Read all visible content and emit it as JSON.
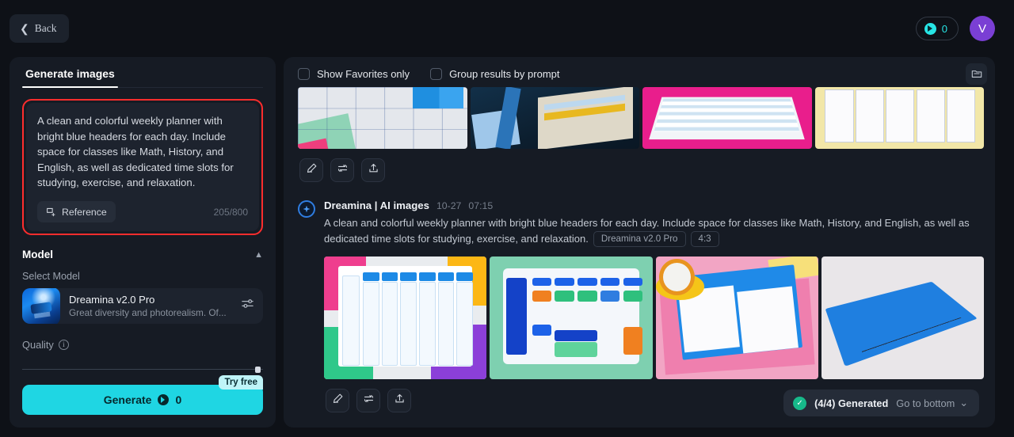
{
  "topbar": {
    "back_label": "Back",
    "back_icon": "chevron-left-icon",
    "credits_value": "0",
    "credits_icon": "credit-coin-icon",
    "avatar_initial": "V",
    "accent_cyan": "#1fd6e3",
    "avatar_color": "#7a3fd4"
  },
  "sidebar": {
    "tab_label": "Generate images",
    "prompt": {
      "text": "A clean and colorful weekly planner with bright blue headers for each day. Include space for classes like Math, History, and English, as well as dedicated time slots for studying, exercise, and relaxation.",
      "reference_label": "Reference",
      "reference_icon": "add-image-icon",
      "counter": "205/800",
      "highlight_color": "#ff2d2d"
    },
    "model_section": {
      "title": "Model",
      "collapse_icon": "chevron-up-icon",
      "select_label": "Select Model",
      "model_name": "Dreamina v2.0 Pro",
      "model_desc": "Great diversity and photorealism. Of...",
      "settings_icon": "sliders-icon"
    },
    "quality": {
      "label": "Quality",
      "info_icon": "info-icon",
      "value_percent": 99
    },
    "generate": {
      "label": "Generate",
      "cost": "0",
      "coin_icon": "credit-coin-icon",
      "try_free_label": "Try free"
    }
  },
  "main": {
    "toolbar": {
      "favorites_label": "Show Favorites only",
      "favorites_checked": false,
      "group_label": "Group results by prompt",
      "group_checked": false,
      "archive_icon": "folder-icon"
    },
    "previous_result": {
      "images": [
        {
          "alt": "weekly planner grid closeup",
          "art": "r1a"
        },
        {
          "alt": "open planner with blue ribbons",
          "art": "r1b"
        },
        {
          "alt": "open planner on pink background",
          "art": "r1c"
        },
        {
          "alt": "fanned planner cards on yellow",
          "art": "r1d"
        }
      ],
      "actions": [
        {
          "name": "edit-button",
          "icon": "pencil-icon"
        },
        {
          "name": "regenerate-button",
          "icon": "loop-arrows-icon"
        },
        {
          "name": "share-button",
          "icon": "upload-icon"
        }
      ]
    },
    "entry": {
      "app_icon": "dreamina-spark-icon",
      "title": "Dreamina | AI images",
      "date": "10-27",
      "time": "07:15",
      "prompt": "A clean and colorful weekly planner with bright blue headers for each day. Include space for classes like Math, History, and English, as well as dedicated time slots for studying, exercise, and relaxation.",
      "tag_model": "Dreamina v2.0 Pro",
      "tag_ratio": "4:3",
      "images": [
        {
          "alt": "weekly planner on colorful background",
          "art": "r2a"
        },
        {
          "alt": "digital weekly planner on mint background",
          "art": "r2b"
        },
        {
          "alt": "blue planner photo on pink desk",
          "art": "r2c"
        },
        {
          "alt": "isometric blue binder with tabs",
          "art": "r2d"
        }
      ],
      "actions": [
        {
          "name": "edit-button",
          "icon": "pencil-icon"
        },
        {
          "name": "regenerate-button",
          "icon": "loop-arrows-icon"
        },
        {
          "name": "share-button",
          "icon": "upload-icon"
        }
      ]
    },
    "status": {
      "check_icon": "check-circle-icon",
      "text": "(4/4) Generated",
      "go_bottom_label": "Go to bottom",
      "chevron_icon": "chevron-down-icon",
      "success_color": "#17b98a"
    }
  }
}
